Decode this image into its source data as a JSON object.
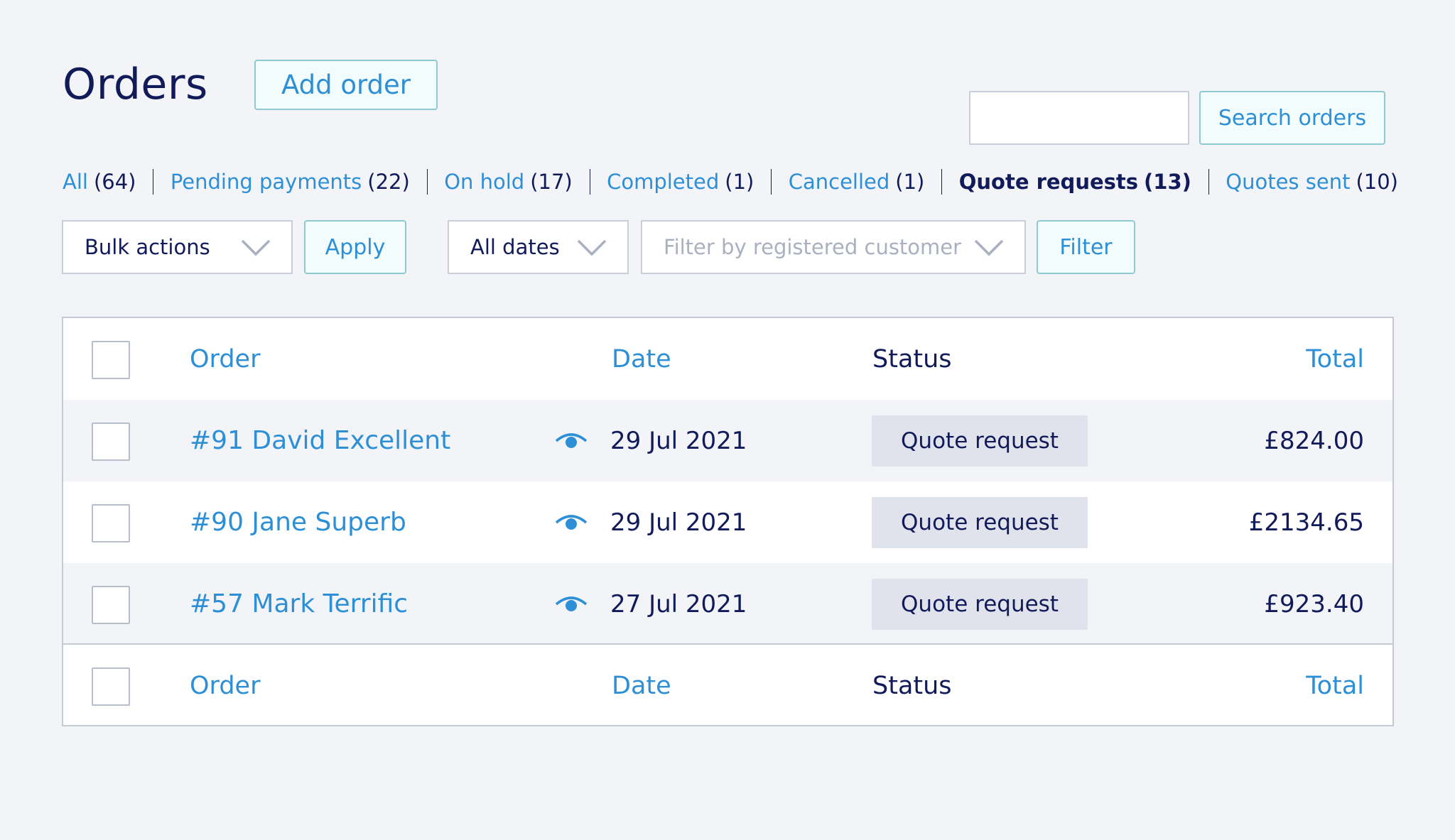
{
  "header": {
    "title": "Orders",
    "add_label": "Add order",
    "search_value": "",
    "search_label": "Search orders"
  },
  "tabs": [
    {
      "label": "All",
      "count": "(64)"
    },
    {
      "label": "Pending payments",
      "count": "(22)"
    },
    {
      "label": "On hold",
      "count": "(17)"
    },
    {
      "label": "Completed",
      "count": "(1)"
    },
    {
      "label": "Cancelled",
      "count": "(1)"
    },
    {
      "label": "Quote requests",
      "count": "(13)",
      "active": true
    },
    {
      "label": "Quotes sent",
      "count": "(10)"
    }
  ],
  "filters": {
    "bulk_actions": "Bulk actions",
    "apply_label": "Apply",
    "dates": "All dates",
    "customer_placeholder": "Filter by registered customer",
    "filter_label": "Filter"
  },
  "table": {
    "columns": {
      "order": "Order",
      "date": "Date",
      "status": "Status",
      "total": "Total"
    },
    "rows": [
      {
        "order": "#91 David Excellent",
        "date": "29 Jul 2021",
        "status": "Quote request",
        "total": "£824.00"
      },
      {
        "order": "#90 Jane Superb",
        "date": "29 Jul 2021",
        "status": "Quote request",
        "total": "£2134.65"
      },
      {
        "order": "#57 Mark Terrific",
        "date": "27 Jul 2021",
        "status": "Quote request",
        "total": "£923.40"
      }
    ]
  },
  "icons": {
    "preview": "eye-icon",
    "dropdown": "chevron-down-icon"
  },
  "colors": {
    "accent": "#2d8fd5",
    "text": "#121b5a",
    "button_border": "#8fcad0",
    "background": "#f3f4f8",
    "status_badge": "#e0e3eb"
  }
}
